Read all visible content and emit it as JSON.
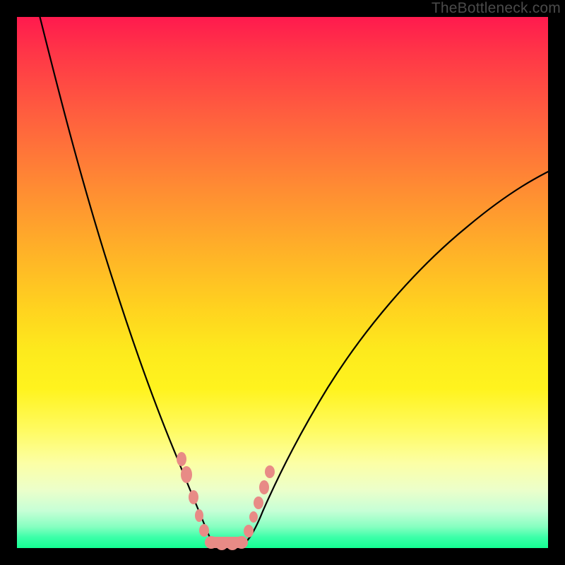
{
  "watermark": "TheBottleneck.com",
  "colors": {
    "frame": "#000000",
    "marker": "#e88b86",
    "curve": "#000000"
  },
  "chart_data": {
    "type": "line",
    "title": "",
    "xlabel": "",
    "ylabel": "",
    "xlim": [
      0,
      100
    ],
    "ylim": [
      0,
      100
    ],
    "grid": false,
    "legend": false,
    "note": "V-shaped bottleneck curve; minimum near x≈38 where bottleneck≈0%. Left branch steep, right branch shallower. Values estimated from pixel positions.",
    "series": [
      {
        "name": "left-branch",
        "x": [
          2,
          5,
          8,
          11,
          14,
          17,
          20,
          23,
          26,
          29,
          31,
          33,
          34.5,
          36,
          37,
          38
        ],
        "y": [
          100,
          90,
          80,
          71,
          62,
          54,
          46,
          38,
          30,
          22,
          16,
          10,
          6,
          3,
          1,
          0
        ]
      },
      {
        "name": "right-branch",
        "x": [
          41,
          43,
          45,
          48,
          52,
          57,
          62,
          68,
          74,
          80,
          86,
          92,
          98,
          100
        ],
        "y": [
          0,
          1,
          3,
          6,
          11,
          17,
          24,
          31,
          38,
          45,
          52,
          59,
          66,
          69
        ]
      }
    ],
    "flat_bottom": {
      "x_from": 34,
      "x_to": 42,
      "y": 0
    },
    "markers": [
      {
        "x": 30.5,
        "y": 17,
        "r": 1.2
      },
      {
        "x": 31.5,
        "y": 14,
        "r": 1.4
      },
      {
        "x": 33.0,
        "y": 9,
        "r": 1.2
      },
      {
        "x": 34.0,
        "y": 5,
        "r": 1.0
      },
      {
        "x": 35.0,
        "y": 2.5,
        "r": 1.2
      },
      {
        "x": 36.5,
        "y": 1,
        "r": 1.2
      },
      {
        "x": 38.0,
        "y": 0.5,
        "r": 1.2
      },
      {
        "x": 39.5,
        "y": 0.5,
        "r": 1.2
      },
      {
        "x": 41.0,
        "y": 0.5,
        "r": 1.2
      },
      {
        "x": 42.5,
        "y": 2,
        "r": 1.2
      },
      {
        "x": 43.5,
        "y": 5,
        "r": 1.0
      },
      {
        "x": 44.5,
        "y": 8,
        "r": 1.2
      },
      {
        "x": 45.5,
        "y": 11,
        "r": 1.2
      },
      {
        "x": 46.5,
        "y": 14,
        "r": 1.2
      }
    ]
  }
}
